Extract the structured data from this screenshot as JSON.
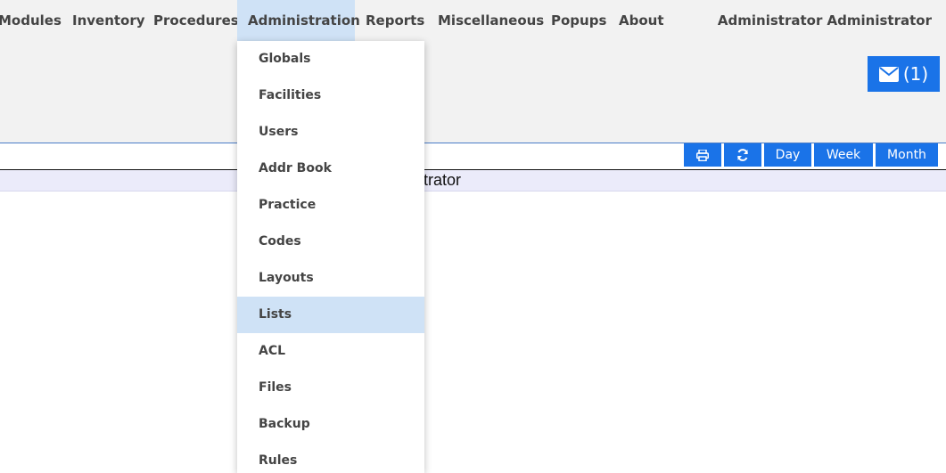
{
  "menubar": {
    "items": [
      {
        "label": "Modules"
      },
      {
        "label": "Inventory"
      },
      {
        "label": "Procedures"
      },
      {
        "label": "Administration"
      },
      {
        "label": "Reports"
      },
      {
        "label": "Miscellaneous"
      },
      {
        "label": "Popups"
      },
      {
        "label": "About"
      }
    ],
    "active": "Administration",
    "user": "Administrator Administrator"
  },
  "messages": {
    "icon": "envelope-icon",
    "count_label": "(1)"
  },
  "calendar": {
    "title_fragment": "strator",
    "buttons": {
      "print_icon": "print-icon",
      "refresh_icon": "refresh-icon",
      "day": "Day",
      "week": "Week",
      "month": "Month"
    }
  },
  "admin_menu": {
    "items": [
      {
        "label": "Globals"
      },
      {
        "label": "Facilities"
      },
      {
        "label": "Users"
      },
      {
        "label": "Addr Book"
      },
      {
        "label": "Practice"
      },
      {
        "label": "Codes"
      },
      {
        "label": "Layouts"
      },
      {
        "label": "Lists"
      },
      {
        "label": "ACL"
      },
      {
        "label": "Files"
      },
      {
        "label": "Backup"
      },
      {
        "label": "Rules"
      }
    ],
    "highlighted": "Lists"
  },
  "colors": {
    "accent": "#1a73e8",
    "menu_highlight": "#cfe2f6",
    "date_band": "#ebebfa"
  }
}
